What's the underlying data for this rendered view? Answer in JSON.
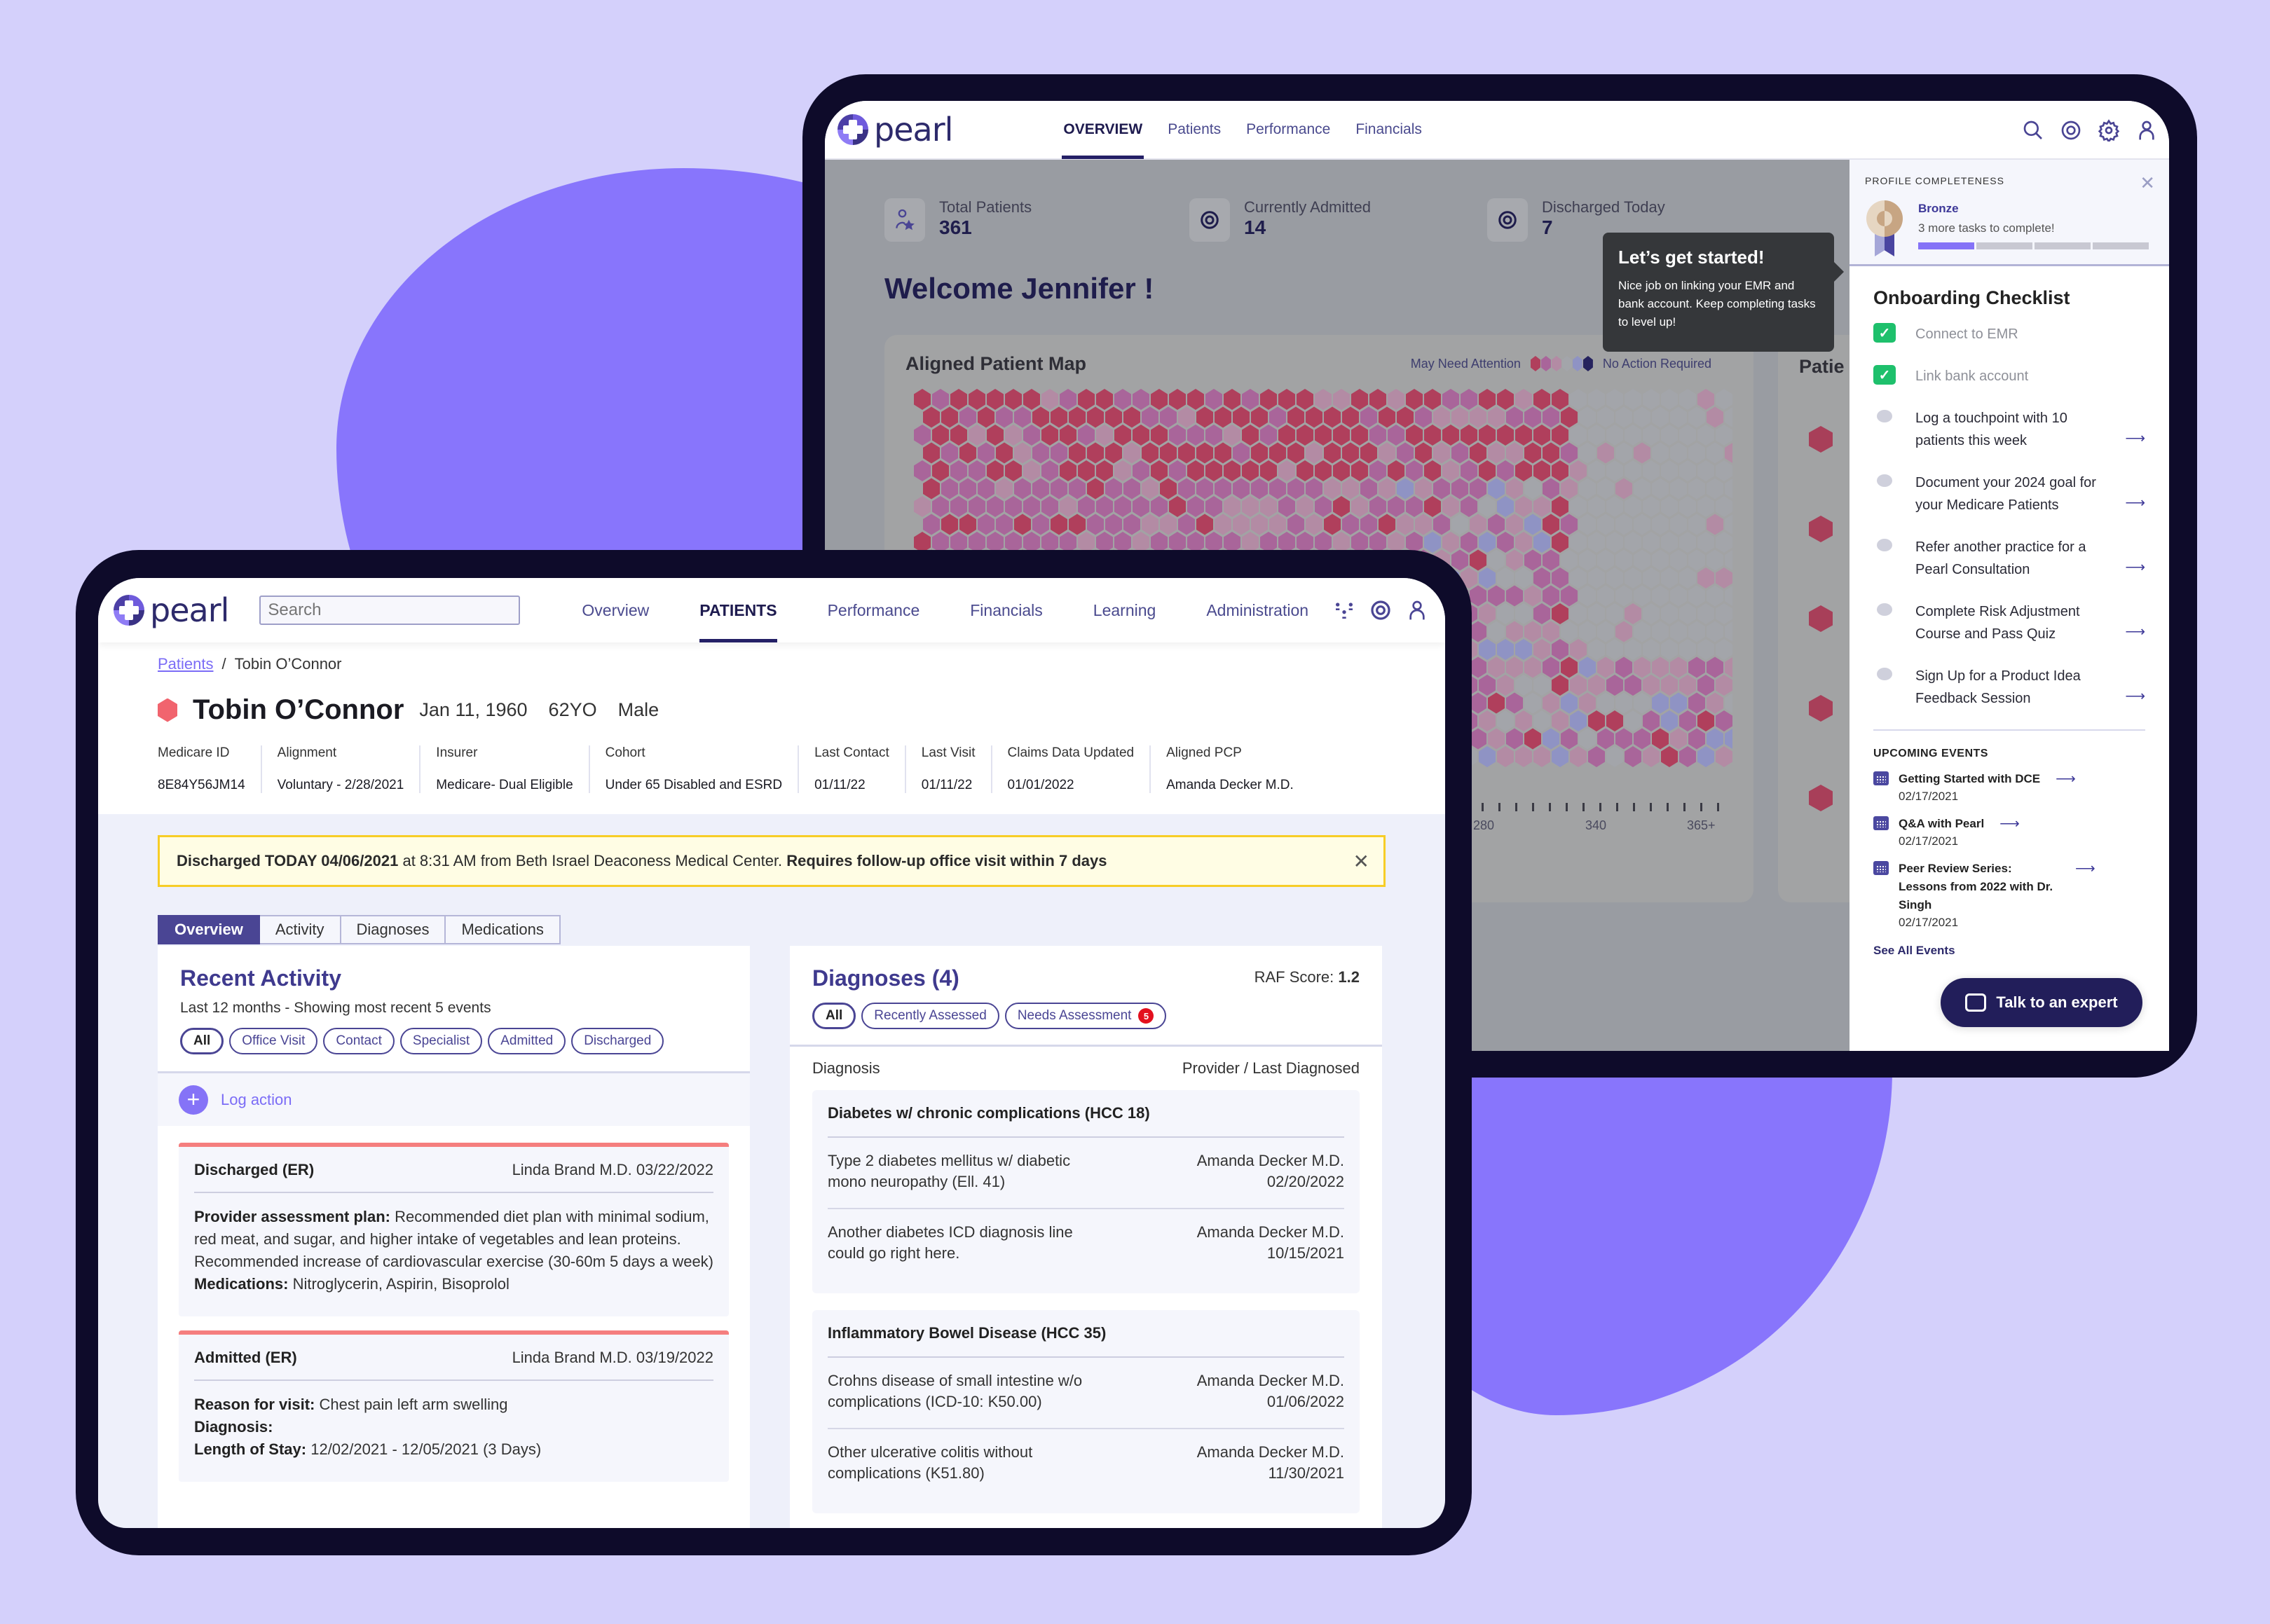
{
  "back_app": {
    "logo_text": "pearl",
    "nav": [
      {
        "label": "OVERVIEW",
        "active": true
      },
      {
        "label": "Patients",
        "active": false
      },
      {
        "label": "Performance",
        "active": false
      },
      {
        "label": "Financials",
        "active": false
      }
    ],
    "stats": [
      {
        "label": "Total Patients",
        "value": "361",
        "icon": "user-star-icon"
      },
      {
        "label": "Currently Admitted",
        "value": "14",
        "icon": "target-icon"
      },
      {
        "label": "Discharged Today",
        "value": "7",
        "icon": "target-icon"
      }
    ],
    "welcome": "Welcome Jennifer !",
    "tooltip": {
      "title": "Let’s get started!",
      "body": "Nice job on linking your EMR and bank account. Keep completing tasks to level up!"
    },
    "map": {
      "title": "Aligned Patient Map",
      "legend_left": "May Need Attention",
      "legend_right": "No Action Required",
      "legend_colors": [
        "#b03f5c",
        "#a9659a",
        "#b38ba4",
        "#a3a5aa",
        "#8f93c4",
        "#25225e"
      ],
      "axis_labels": [
        "280",
        "340",
        "365+"
      ]
    },
    "side_card_title": "Patie",
    "profile": {
      "label": "PROFILE COMPLETENESS",
      "level": "Bronze",
      "tasks_remaining": "3 more tasks to complete!",
      "progress_segments_done": 1,
      "progress_segments_total": 4
    },
    "onboarding": {
      "title": "Onboarding Checklist",
      "items": [
        {
          "label": "Connect to EMR",
          "done": true
        },
        {
          "label": "Link bank account",
          "done": true
        },
        {
          "label": "Log a touchpoint with 10 patients this week",
          "done": false
        },
        {
          "label": "Document your 2024 goal for your Medicare Patients",
          "done": false
        },
        {
          "label": "Refer another practice for a Pearl Consultation",
          "done": false
        },
        {
          "label": "Complete Risk Adjustment Course and Pass Quiz",
          "done": false
        },
        {
          "label": "Sign Up for a Product Idea Feedback Session",
          "done": false
        }
      ]
    },
    "events": {
      "title": "UPCOMING EVENTS",
      "items": [
        {
          "name": "Getting Started with DCE",
          "date": "02/17/2021"
        },
        {
          "name": "Q&A with Pearl",
          "date": "02/17/2021"
        },
        {
          "name": "Peer Review Series: Lessons from 2022 with Dr. Singh",
          "date": "02/17/2021"
        }
      ],
      "see_all": "See All Events"
    },
    "talk_button": "Talk to an expert"
  },
  "front_app": {
    "logo_text": "pearl",
    "search_placeholder": "Search",
    "nav": [
      {
        "label": "Overview",
        "active": false
      },
      {
        "label": "PATIENTS",
        "active": true
      },
      {
        "label": "Performance",
        "active": false
      },
      {
        "label": "Financials",
        "active": false
      },
      {
        "label": "Learning",
        "active": false
      },
      {
        "label": "Administration",
        "active": false
      }
    ],
    "breadcrumb": {
      "parent": "Patients",
      "separator": "/",
      "current": "Tobin O’Connor"
    },
    "patient": {
      "name": "Tobin O’Connor",
      "dob": "Jan 11, 1960",
      "age": "62YO",
      "sex": "Male",
      "fields": [
        {
          "label": "Medicare ID",
          "value": "8E84Y56JM14"
        },
        {
          "label": "Alignment",
          "value": "Voluntary - 2/28/2021"
        },
        {
          "label": "Insurer",
          "value": "Medicare- Dual Eligible"
        },
        {
          "label": "Cohort",
          "value": "Under 65 Disabled and ESRD"
        },
        {
          "label": "Last Contact",
          "value": "01/11/22"
        },
        {
          "label": "Last Visit",
          "value": "01/11/22"
        },
        {
          "label": "Claims Data Updated",
          "value": "01/01/2022"
        },
        {
          "label": "Aligned PCP",
          "value": "Amanda Decker M.D."
        }
      ]
    },
    "alert": {
      "bold1": "Discharged TODAY 04/06/2021",
      "text": " at 8:31 AM from Beth Israel Deaconess Medical Center. ",
      "bold2": "Requires follow-up office visit within 7 days"
    },
    "tabs": [
      {
        "label": "Overview",
        "active": true
      },
      {
        "label": "Activity",
        "active": false
      },
      {
        "label": "Diagnoses",
        "active": false
      },
      {
        "label": "Medications",
        "active": false
      }
    ],
    "recent_activity": {
      "title": "Recent Activity",
      "subtitle": "Last 12 months - Showing most recent 5 events",
      "filters": [
        {
          "label": "All",
          "active": true
        },
        {
          "label": "Office Visit",
          "active": false
        },
        {
          "label": "Contact",
          "active": false
        },
        {
          "label": "Specialist",
          "active": false
        },
        {
          "label": "Admitted",
          "active": false
        },
        {
          "label": "Discharged",
          "active": false
        }
      ],
      "log_action": "Log action",
      "events": [
        {
          "type": "Discharged (ER)",
          "provider": "Linda Brand M.D.",
          "date": "03/22/2022",
          "lines": [
            {
              "label": "Provider assessment plan:",
              "text": " Recommended diet plan with minimal sodium, red meat, and sugar, and higher intake of vegetables and lean proteins. Recommended increase of cardiovascular exercise (30-60m 5 days a week)"
            },
            {
              "label": "Medications:",
              "text": " Nitroglycerin, Aspirin, Bisoprolol"
            }
          ]
        },
        {
          "type": "Admitted (ER)",
          "provider": "Linda Brand M.D.",
          "date": "03/19/2022",
          "lines": [
            {
              "label": "Reason for visit:",
              "text": " Chest pain left arm swelling"
            },
            {
              "label": "Diagnosis:",
              "text": ""
            },
            {
              "label": "Length of Stay:",
              "text": " 12/02/2021 - 12/05/2021 (3 Days)"
            }
          ]
        }
      ]
    },
    "diagnoses": {
      "title": "Diagnoses (4)",
      "raf_label": "RAF Score:",
      "raf_value": "1.2",
      "filters": [
        {
          "label": "All",
          "active": true,
          "badge": null
        },
        {
          "label": "Recently Assessed",
          "active": false,
          "badge": null
        },
        {
          "label": "Needs Assessment",
          "active": false,
          "badge": "5"
        }
      ],
      "col_left": "Diagnosis",
      "col_right": "Provider / Last Diagnosed",
      "groups": [
        {
          "title": "Diabetes w/ chronic complications (HCC 18)",
          "rows": [
            {
              "dx": "Type 2 diabetes mellitus w/ diabetic mono neuropathy (Ell. 41)",
              "provider": "Amanda Decker M.D.",
              "date": "02/20/2022"
            },
            {
              "dx": "Another diabetes ICD diagnosis line could go right here.",
              "provider": "Amanda Decker M.D.",
              "date": "10/15/2021"
            }
          ]
        },
        {
          "title": "Inflammatory Bowel Disease (HCC 35)",
          "rows": [
            {
              "dx": "Crohns disease of small intestine w/o complications (ICD-10: K50.00)",
              "provider": "Amanda Decker M.D.",
              "date": "01/06/2022"
            },
            {
              "dx": "Other ulcerative colitis without complications (K51.80)",
              "provider": "Amanda Decker M.D.",
              "date": "11/30/2021"
            }
          ]
        }
      ]
    }
  }
}
